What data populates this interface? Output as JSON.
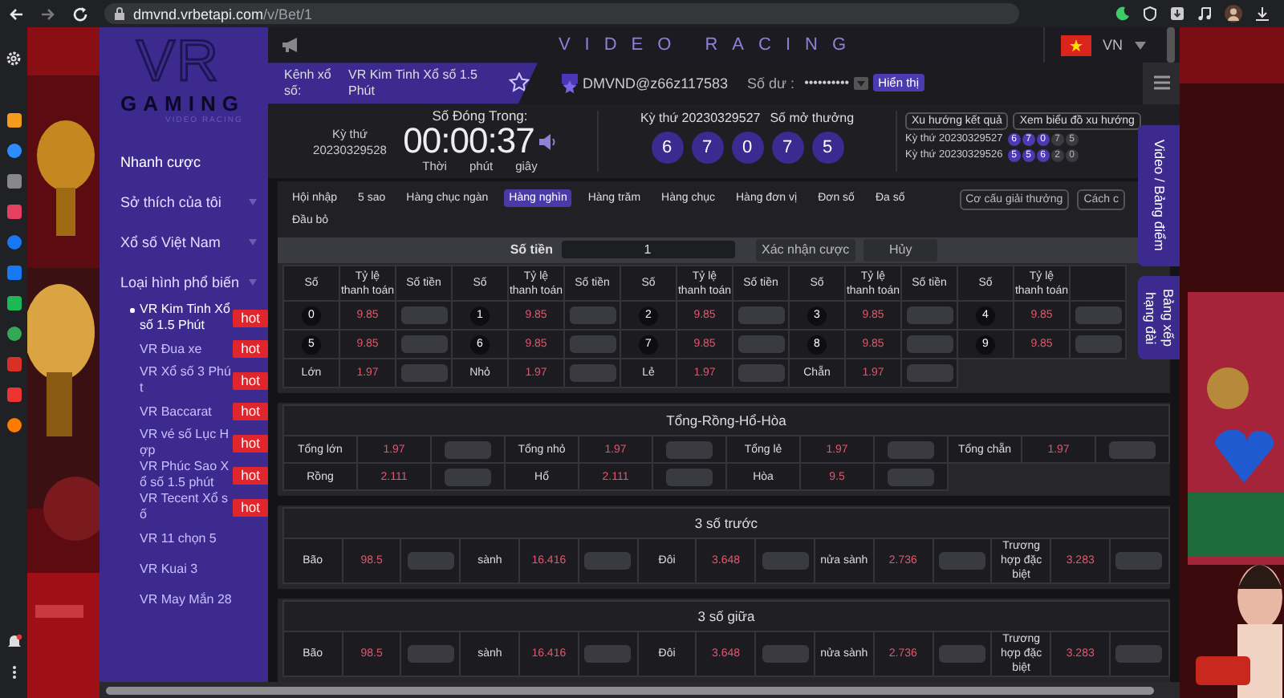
{
  "browser": {
    "url_host": "dmvnd.vrbetapi.com",
    "url_path": "/v/Bet/1"
  },
  "header": {
    "title": "VIDEO RACING",
    "language": "VN"
  },
  "logo": {
    "letters": "VR",
    "word": "GAMING",
    "tagline": "VIDEO RACING"
  },
  "sidebar": {
    "items": [
      {
        "label": "Nhanh cược",
        "expandable": false
      },
      {
        "label": "Sở thích của tôi",
        "expandable": true
      },
      {
        "label": "Xổ số Việt Nam",
        "expandable": true
      },
      {
        "label": "Loại hình phổ biến",
        "expandable": true,
        "children": [
          {
            "label": "VR Kim Tinh Xổ số 1.5 Phút",
            "badge": "hot",
            "selected": true
          },
          {
            "label": "VR Đua xe",
            "badge": "hot",
            "selected": false
          },
          {
            "label": "VR Xổ số 3 Phút",
            "badge": "hot",
            "selected": false
          },
          {
            "label": "VR Baccarat",
            "badge": "hot",
            "selected": false
          },
          {
            "label": "VR vé số Lục Hợp",
            "badge": "hot",
            "selected": false
          },
          {
            "label": "VR Phúc Sao Xổ số 1.5 phút",
            "badge": "hot",
            "selected": false
          },
          {
            "label": "VR Tecent Xổ số",
            "badge": "hot",
            "selected": false
          },
          {
            "label": "VR 11 chọn 5",
            "selected": false
          },
          {
            "label": "VR Kuai 3",
            "selected": false
          },
          {
            "label": "VR May Mắn 28",
            "selected": false
          }
        ]
      }
    ]
  },
  "info": {
    "channel_label": "Kênh xổ số:",
    "channel": "VR Kim Tinh Xổ số 1.5 Phút",
    "favorite": false,
    "user": "DMVND@z66z117583",
    "balance_label": "Số dư :",
    "balance": "••••••••••",
    "show_button": "Hiển thị"
  },
  "countdown": {
    "period_label": "Kỳ thứ",
    "period": "20230329528",
    "title": "Số Đóng Trong:",
    "time": "00:00:37",
    "units": [
      "Thời",
      "phút",
      "giây"
    ]
  },
  "result": {
    "period": "Kỳ thứ 20230329527",
    "title": "Số mở thưởng",
    "balls": [
      "6",
      "7",
      "0",
      "7",
      "5"
    ]
  },
  "trend_buttons": [
    "Xu hướng kết quả",
    "Xem biểu đồ xu hướng"
  ],
  "history": [
    {
      "period": "Kỳ thứ 20230329527",
      "balls": [
        {
          "value": "6",
          "highlighted": true
        },
        {
          "value": "7",
          "highlighted": true
        },
        {
          "value": "0",
          "highlighted": true
        },
        {
          "value": "7",
          "highlighted": false
        },
        {
          "value": "5",
          "highlighted": false
        }
      ]
    },
    {
      "period": "Kỳ thứ 20230329526",
      "balls": [
        {
          "value": "5",
          "highlighted": true
        },
        {
          "value": "5",
          "highlighted": true
        },
        {
          "value": "6",
          "highlighted": true
        },
        {
          "value": "2",
          "highlighted": false
        },
        {
          "value": "0",
          "highlighted": false
        }
      ]
    }
  ],
  "tabs": [
    {
      "label": "Hội nhập",
      "selected": false
    },
    {
      "label": "5 sao",
      "selected": false
    },
    {
      "label": "Hàng chục ngàn",
      "selected": false
    },
    {
      "label": "Hàng nghìn",
      "selected": true
    },
    {
      "label": "Hàng trăm",
      "selected": false
    },
    {
      "label": "Hàng chục",
      "selected": false
    },
    {
      "label": "Hàng đơn vị",
      "selected": false
    },
    {
      "label": "Đơn số",
      "selected": false
    },
    {
      "label": "Đa số",
      "selected": false
    },
    {
      "label": "Đầu bỏ",
      "selected": false
    }
  ],
  "tab_tools": [
    "Cơ cấu giải thưởng",
    "Cách c"
  ],
  "bet": {
    "label": "Số tiền",
    "amount": "1",
    "confirm": "Xác nhận cược",
    "cancel": "Hủy"
  },
  "number_table": {
    "groups": [
      {
        "headers": [
          "Số",
          "Tỷ lệ thanh toán",
          "Số tiền"
        ],
        "rows": [
          {
            "label": "0",
            "kind": "ball",
            "odds": "9.85"
          },
          {
            "label": "5",
            "kind": "ball",
            "odds": "9.85"
          },
          {
            "label": "Lớn",
            "kind": "text",
            "odds": "1.97"
          }
        ]
      },
      {
        "headers": [
          "Số",
          "Tỷ lệ thanh toán",
          "Số tiền"
        ],
        "rows": [
          {
            "label": "1",
            "kind": "ball",
            "odds": "9.85"
          },
          {
            "label": "6",
            "kind": "ball",
            "odds": "9.85"
          },
          {
            "label": "Nhỏ",
            "kind": "text",
            "odds": "1.97"
          }
        ]
      },
      {
        "headers": [
          "Số",
          "Tỷ lệ thanh toán",
          "Số tiền"
        ],
        "rows": [
          {
            "label": "2",
            "kind": "ball",
            "odds": "9.85"
          },
          {
            "label": "7",
            "kind": "ball",
            "odds": "9.85"
          },
          {
            "label": "Lẻ",
            "kind": "text",
            "odds": "1.97"
          }
        ]
      },
      {
        "headers": [
          "Số",
          "Tỷ lệ thanh toán",
          "Số tiền"
        ],
        "rows": [
          {
            "label": "3",
            "kind": "ball",
            "odds": "9.85"
          },
          {
            "label": "8",
            "kind": "ball",
            "odds": "9.85"
          },
          {
            "label": "Chẵn",
            "kind": "text",
            "odds": "1.97"
          }
        ]
      },
      {
        "headers": [
          "Số",
          "Tỷ lệ thanh toán"
        ],
        "rows": [
          {
            "label": "4",
            "kind": "ball",
            "odds": "9.85"
          },
          {
            "label": "9",
            "kind": "ball",
            "odds": "9.85"
          }
        ]
      }
    ]
  },
  "panels": [
    {
      "title": "Tổng-Rồng-Hổ-Hòa",
      "rows": [
        [
          {
            "label": "Tổng lớn",
            "odds": "1.97"
          },
          {
            "label": "Tổng nhỏ",
            "odds": "1.97"
          },
          {
            "label": "Tổng lẻ",
            "odds": "1.97"
          },
          {
            "label": "Tổng chẵn",
            "odds": "1.97"
          }
        ],
        [
          {
            "label": "Rồng",
            "odds": "2.111"
          },
          {
            "label": "Hổ",
            "odds": "2.111"
          },
          {
            "label": "Hòa",
            "odds": "9.5"
          }
        ]
      ]
    },
    {
      "title": "3 số trước",
      "rows": [
        [
          {
            "label": "Bão",
            "odds": "98.5"
          },
          {
            "label": "sành",
            "odds": "16.416"
          },
          {
            "label": "Đôi",
            "odds": "3.648"
          },
          {
            "label": "nửa sành",
            "odds": "2.736"
          },
          {
            "label": "Trương hợp đặc biệt",
            "odds": "3.283"
          }
        ]
      ]
    },
    {
      "title": "3 số giữa",
      "rows": [
        [
          {
            "label": "Bão",
            "odds": "98.5"
          },
          {
            "label": "sành",
            "odds": "16.416"
          },
          {
            "label": "Đôi",
            "odds": "3.648"
          },
          {
            "label": "nửa sành",
            "odds": "2.736"
          },
          {
            "label": "Trương hợp đặc biệt",
            "odds": "3.283"
          }
        ]
      ]
    }
  ],
  "side_tabs": [
    "Video / Bảng điểm",
    "Bảng xếp hạng đài"
  ]
}
